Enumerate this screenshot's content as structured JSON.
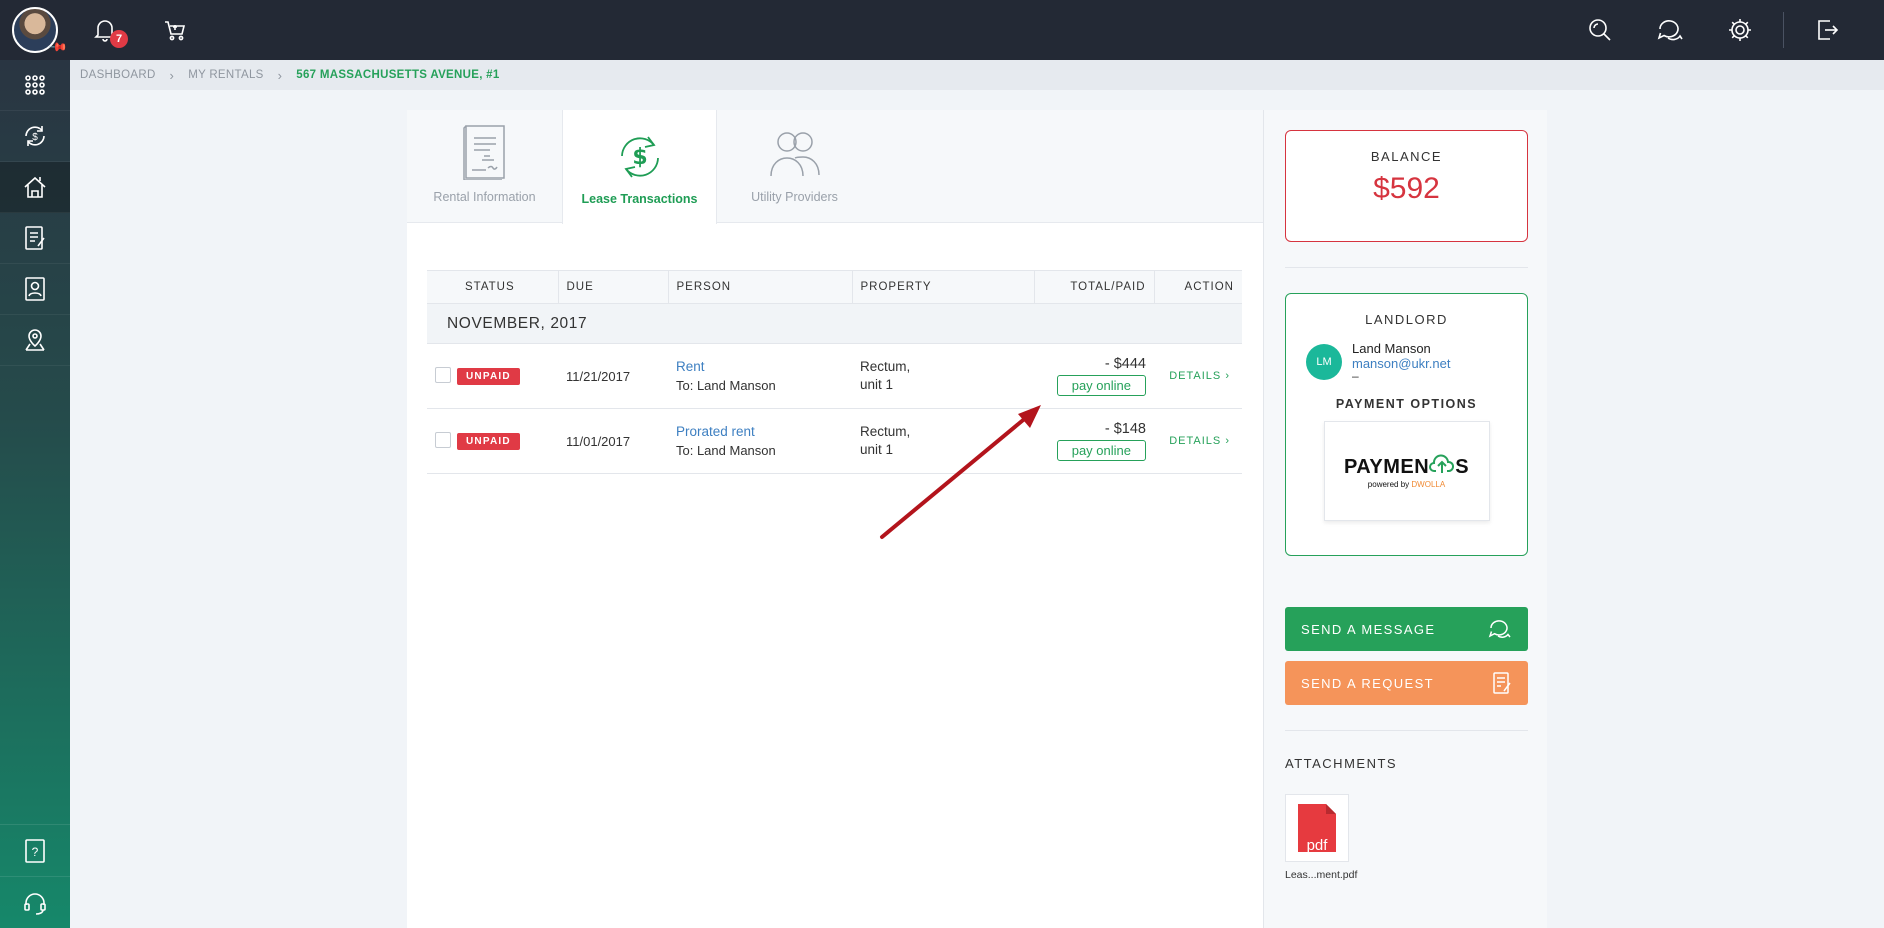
{
  "topbar": {
    "notification_count": "7"
  },
  "breadcrumb": {
    "items": [
      "DASHBOARD",
      "MY RENTALS"
    ],
    "current": "567 MASSACHUSETTS AVENUE, #1"
  },
  "tabs": [
    {
      "label": "Rental Information"
    },
    {
      "label": "Lease Transactions"
    },
    {
      "label": "Utility Providers"
    }
  ],
  "table": {
    "headers": [
      "STATUS",
      "DUE",
      "PERSON",
      "PROPERTY",
      "TOTAL/PAID",
      "ACTION"
    ],
    "month": "NOVEMBER, 2017",
    "rows": [
      {
        "status": "UNPAID",
        "due": "11/21/2017",
        "person": "Rent",
        "to": "To: Land Manson",
        "property_1": "Rectum,",
        "property_2": "unit 1",
        "total": "- $444",
        "pay": "pay online",
        "action": "DETAILS ›"
      },
      {
        "status": "UNPAID",
        "due": "11/01/2017",
        "person": "Prorated rent",
        "to": "To: Land Manson",
        "property_1": "Rectum,",
        "property_2": "unit 1",
        "total": "- $148",
        "pay": "pay online",
        "action": "DETAILS ›"
      }
    ]
  },
  "balance": {
    "label": "BALANCE",
    "value": "$592"
  },
  "landlord": {
    "title": "LANDLORD",
    "initials": "LM",
    "name": "Land Manson",
    "email": "manson@ukr.net",
    "phone": "–",
    "payment_title": "PAYMENT OPTIONS",
    "payment_logo_a": "PAYMEN",
    "payment_logo_b": "S",
    "payment_sub": "powered by",
    "payment_sub_brand": "DWOLLA"
  },
  "buttons": {
    "message": "SEND A MESSAGE",
    "request": "SEND A REQUEST"
  },
  "attachments": {
    "title": "ATTACHMENTS",
    "file_type": "pdf",
    "file_name": "Leas...ment.pdf"
  },
  "colors": {
    "accent_green": "#26a15a",
    "danger_red": "#d6343f",
    "request_orange": "#f5945a",
    "annotation_arrow": "#b3141c"
  }
}
